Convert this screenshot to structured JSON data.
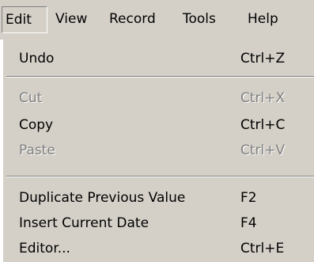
{
  "menubar": {
    "items": [
      {
        "label": "Edit",
        "active": true
      },
      {
        "label": "View"
      },
      {
        "label": "Record"
      },
      {
        "label": "Tools"
      },
      {
        "label": "Help"
      }
    ]
  },
  "dropdown": {
    "items": [
      {
        "label": "Undo",
        "shortcut": "Ctrl+Z",
        "enabled": true
      },
      {
        "label": "Cut",
        "shortcut": "Ctrl+X",
        "enabled": false
      },
      {
        "label": "Copy",
        "shortcut": "Ctrl+C",
        "enabled": true
      },
      {
        "label": "Paste",
        "shortcut": "Ctrl+V",
        "enabled": false
      },
      {
        "label": "Duplicate Previous Value",
        "shortcut": "F2",
        "enabled": true
      },
      {
        "label": "Insert Current Date",
        "shortcut": "F4",
        "enabled": true
      },
      {
        "label": "Editor...",
        "shortcut": "Ctrl+E",
        "enabled": true
      }
    ]
  },
  "colors": {
    "menu_background": "#d4d0c8",
    "disabled_text": "#808080",
    "highlight_edge": "#ffffff",
    "shadow_edge": "#808080"
  }
}
